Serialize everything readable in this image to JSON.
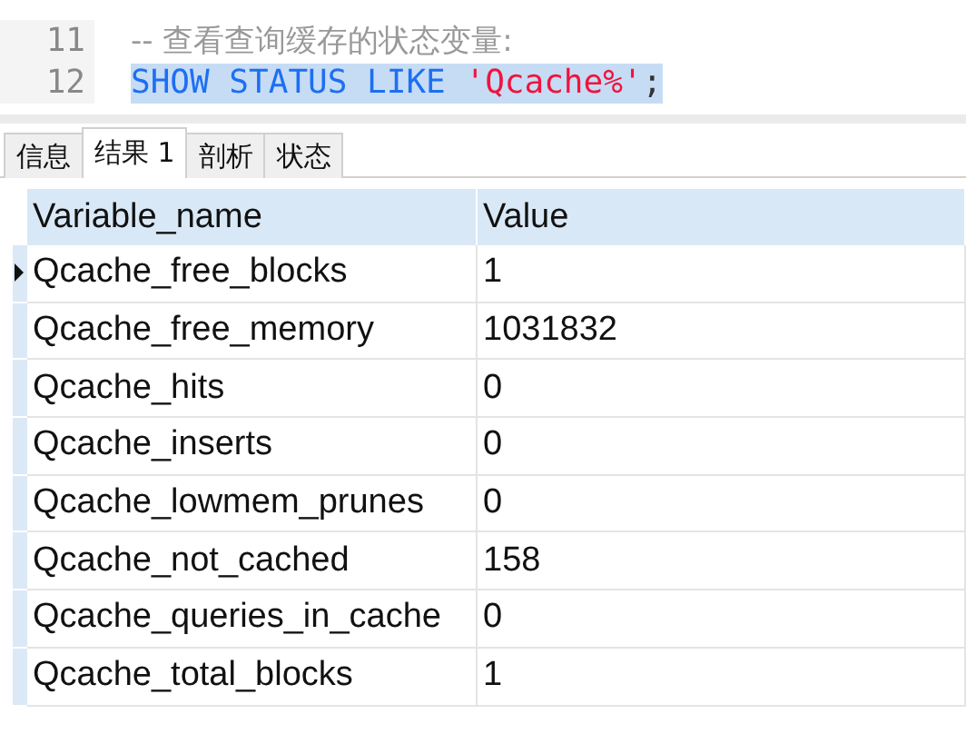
{
  "editor": {
    "lines": [
      {
        "number": "11",
        "selected": false,
        "tokens": [
          {
            "kind": "comment",
            "text": "-- 查看查询缓存的状态变量:"
          }
        ]
      },
      {
        "number": "12",
        "selected": true,
        "tokens": [
          {
            "kind": "keyword",
            "text": "SHOW STATUS LIKE "
          },
          {
            "kind": "string",
            "text": "'Qcache%'"
          },
          {
            "kind": "plain",
            "text": ";"
          }
        ]
      }
    ]
  },
  "tabs": [
    {
      "label": "信息",
      "selected": false
    },
    {
      "label": "结果 1",
      "selected": true
    },
    {
      "label": "剖析",
      "selected": false
    },
    {
      "label": "状态",
      "selected": false
    }
  ],
  "table": {
    "columns": [
      "Variable_name",
      "Value"
    ],
    "rows": [
      {
        "cells": [
          "Qcache_free_blocks",
          "1"
        ],
        "selected": true
      },
      {
        "cells": [
          "Qcache_free_memory",
          "1031832"
        ],
        "selected": false
      },
      {
        "cells": [
          "Qcache_hits",
          "0"
        ],
        "selected": false
      },
      {
        "cells": [
          "Qcache_inserts",
          "0"
        ],
        "selected": false
      },
      {
        "cells": [
          "Qcache_lowmem_prunes",
          "0"
        ],
        "selected": false
      },
      {
        "cells": [
          "Qcache_not_cached",
          "158"
        ],
        "selected": false
      },
      {
        "cells": [
          "Qcache_queries_in_cache",
          "0"
        ],
        "selected": false
      },
      {
        "cells": [
          "Qcache_total_blocks",
          "1"
        ],
        "selected": false
      }
    ]
  }
}
